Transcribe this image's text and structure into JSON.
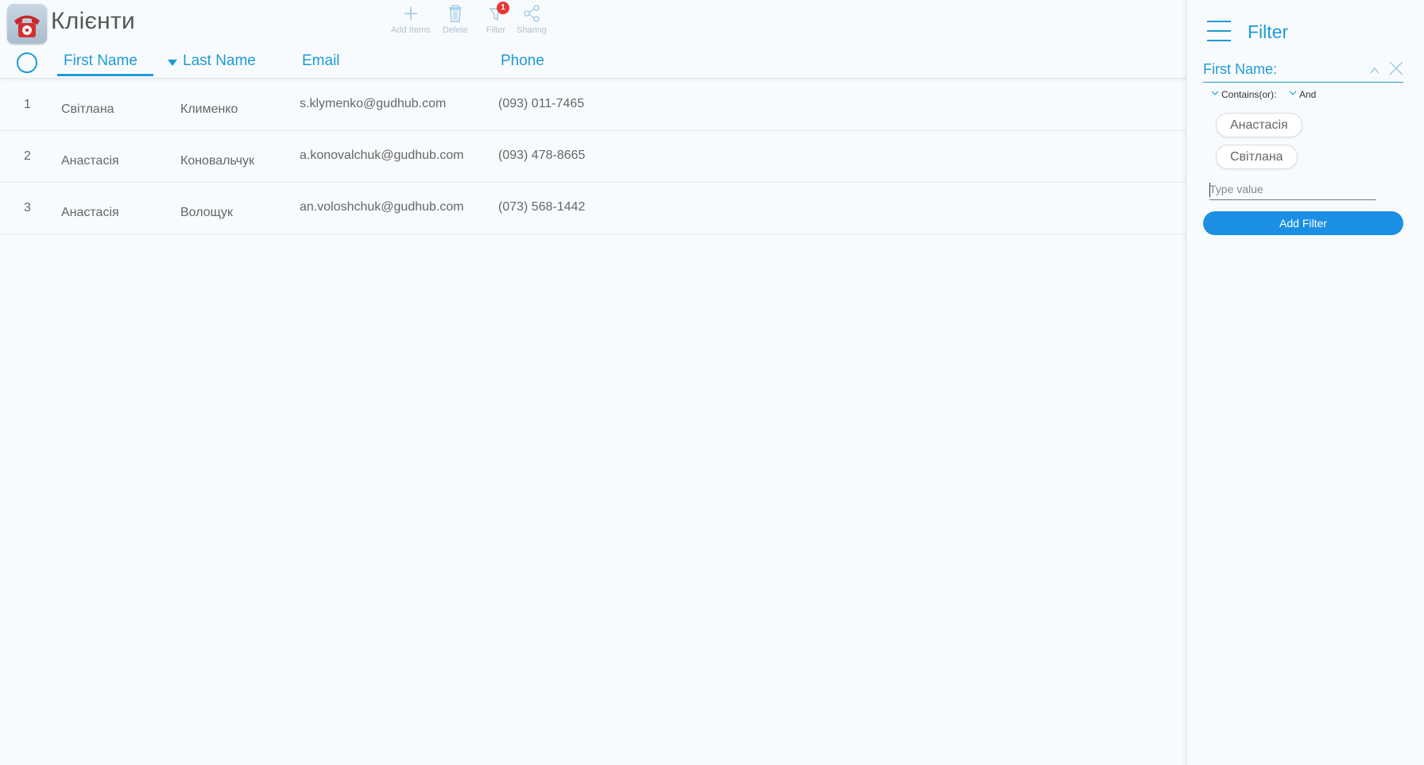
{
  "app": {
    "title": "Клієнти",
    "icon": "red-telephone-icon"
  },
  "toolbar": {
    "items": [
      {
        "label": "Add Items",
        "icon": "plus-icon"
      },
      {
        "label": "Delete",
        "icon": "trash-icon"
      },
      {
        "label": "Filter",
        "icon": "filter-icon",
        "badge": "1"
      },
      {
        "label": "Sharing",
        "icon": "share-icon"
      }
    ]
  },
  "table": {
    "columns": [
      "First Name",
      "Last Name",
      "Email",
      "Phone"
    ],
    "rows": [
      {
        "num": "1",
        "first": "Світлана",
        "last": "Клименко",
        "email": "s.klymenko@gudhub.com",
        "phone": "(093) 011-7465"
      },
      {
        "num": "2",
        "first": "Анастасія",
        "last": "Коновальчук",
        "email": "a.konovalchuk@gudhub.com",
        "phone": "(093) 478-8665"
      },
      {
        "num": "3",
        "first": "Анастасія",
        "last": "Волощук",
        "email": "an.voloshchuk@gudhub.com",
        "phone": "(073) 568-1442"
      }
    ]
  },
  "filter_panel": {
    "title": "Filter",
    "field_label": "First Name:",
    "condition": "Contains(or):",
    "logic": "And",
    "values": [
      "Анастасія",
      "Світлана"
    ],
    "input_placeholder": "Type value",
    "add_button": "Add Filter"
  },
  "colors": {
    "accent": "#1e9ad6",
    "button": "#1a8fe3",
    "badge": "#e53935",
    "background": "#f8fbfd"
  }
}
